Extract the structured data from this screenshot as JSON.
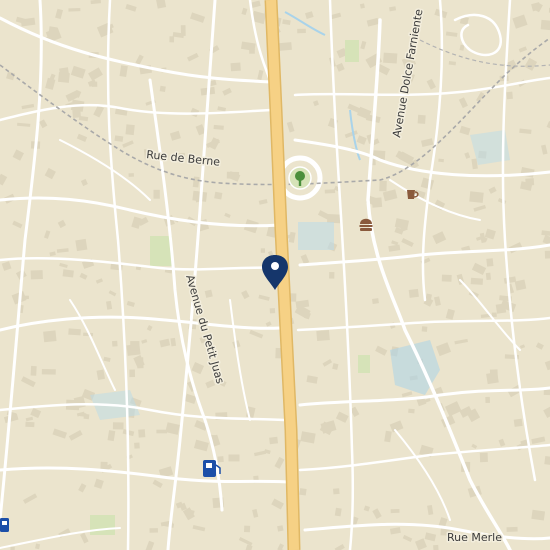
{
  "map": {
    "street_labels": [
      {
        "id": "rue-de-berne",
        "text": "Rue de Berne"
      },
      {
        "id": "avenue-du-petit-juas",
        "text": "Avenue du Petit Juas"
      },
      {
        "id": "avenue-dolce-farniente",
        "text": "Avenue Dolce Farniente"
      },
      {
        "id": "rue-merle",
        "text": "Rue Merle"
      }
    ],
    "pois": [
      {
        "id": "park",
        "icon": "tree-icon",
        "color": "#4a8f3c"
      },
      {
        "id": "cafe",
        "icon": "coffee-cup-icon",
        "color": "#8a5a3c"
      },
      {
        "id": "fast-food",
        "icon": "burger-icon",
        "color": "#8a5a3c"
      },
      {
        "id": "fuel",
        "icon": "fuel-pump-icon",
        "color": "#1c4fa8"
      },
      {
        "id": "transit",
        "icon": "bus-stop-icon",
        "color": "#1c4fa8"
      }
    ],
    "marker": {
      "icon": "location-pin-icon",
      "color": "#15366b"
    },
    "colors": {
      "land": "#ebe4cd",
      "building": "#ddd5bd",
      "street": "#ffffff",
      "main_road": "#f6d185",
      "main_road_casing": "#e0b865",
      "park": "#d6e3b8",
      "water": "#a9d3ea",
      "railway": "#a9a9a9"
    }
  }
}
